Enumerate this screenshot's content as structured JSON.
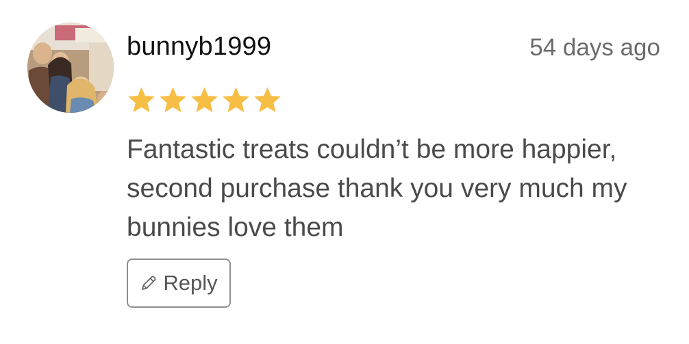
{
  "review": {
    "username": "bunnyb1999",
    "timestamp": "54 days ago",
    "rating": 5,
    "rating_max": 5,
    "star_color": "#F6BE45",
    "text": "Fantastic treats couldn’t be more happier, second purchase thank you very much my bunnies love them",
    "reply_label": "Reply",
    "reply_icon": "pencil-icon",
    "avatar_icon": "user-photo-avatar"
  }
}
